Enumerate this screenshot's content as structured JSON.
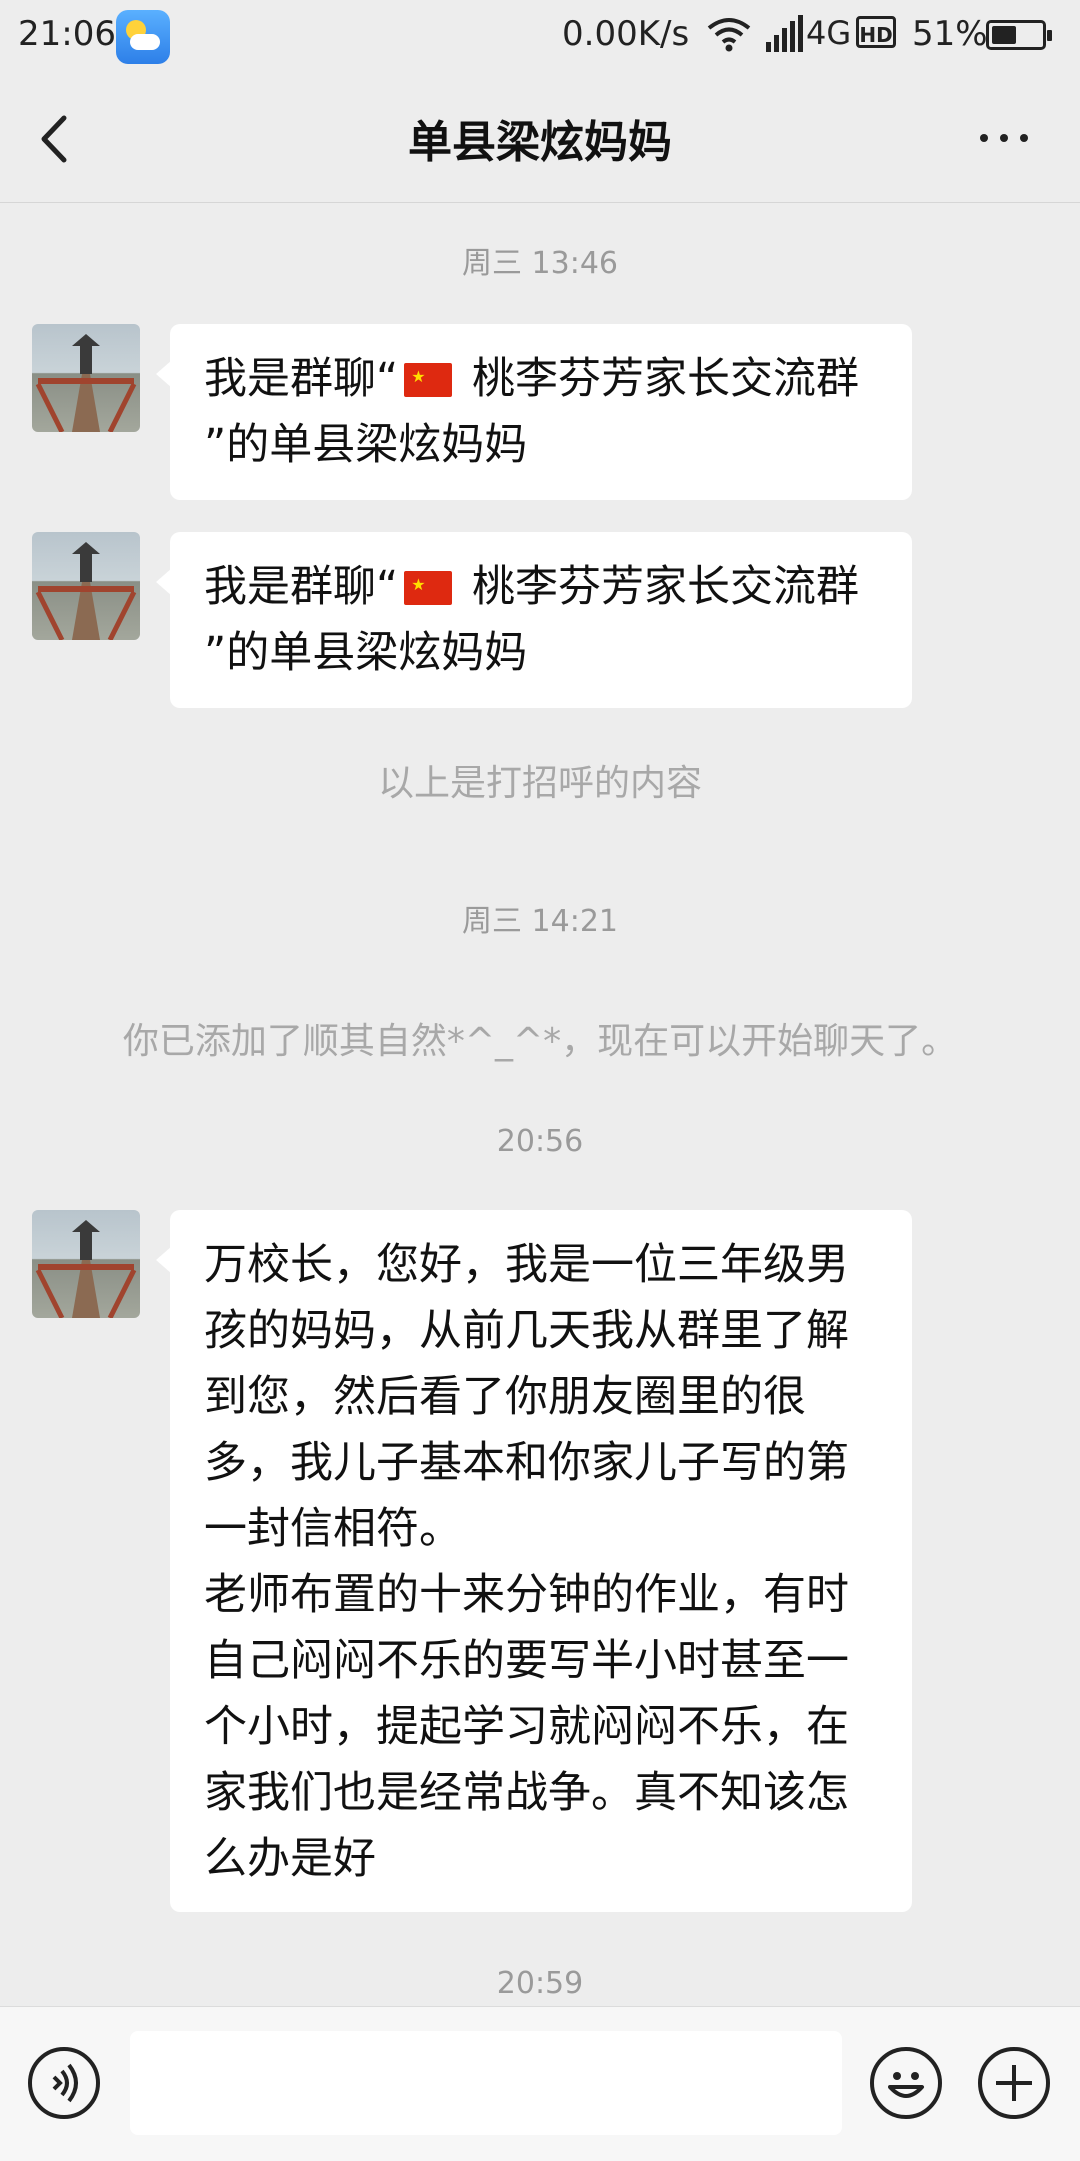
{
  "status_bar": {
    "time": "21:06",
    "weather_icon": "weather-partly-cloudy-icon",
    "net_speed": "0.00K/s",
    "network": "4G",
    "hd": "HD",
    "battery_percent": "51%",
    "battery_level": 0.51
  },
  "header": {
    "title": "单县梁炫妈妈",
    "back_icon": "chevron-left-icon",
    "more_icon": "more-dots-icon"
  },
  "chat": {
    "time1": "周三 13:46",
    "greeting1_a": "我是群聊“",
    "greeting1_b": " 桃李芬芳家长交流群",
    "greeting1_c": "”的单县梁炫妈妈",
    "greeting2_a": "我是群聊“",
    "greeting2_b": " 桃李芬芳家长交流群",
    "greeting2_c": "”的单县梁炫妈妈",
    "greeting_note": "以上是打招呼的内容",
    "time2": "周三 14:21",
    "added_note": "你已添加了顺其自然*^_^*，现在可以开始聊天了。",
    "time3": "20:56",
    "message": "万校长，您好，我是一位三年级男孩的妈妈，从前几天我从群里了解到您，然后看了你朋友圈里的很多，我儿子基本和你家儿子写的第一封信相符。\n老师布置的十来分钟的作业，有时自己闷闷不乐的要写半小时甚至一个小时，提起学习就闷闷不乐，在家我们也是经常战争。真不知该怎么办是好",
    "time4": "20:59"
  },
  "input_bar": {
    "voice_icon": "voice-icon",
    "text_value": "",
    "emoji_icon": "emoji-icon",
    "plus_icon": "plus-icon"
  }
}
